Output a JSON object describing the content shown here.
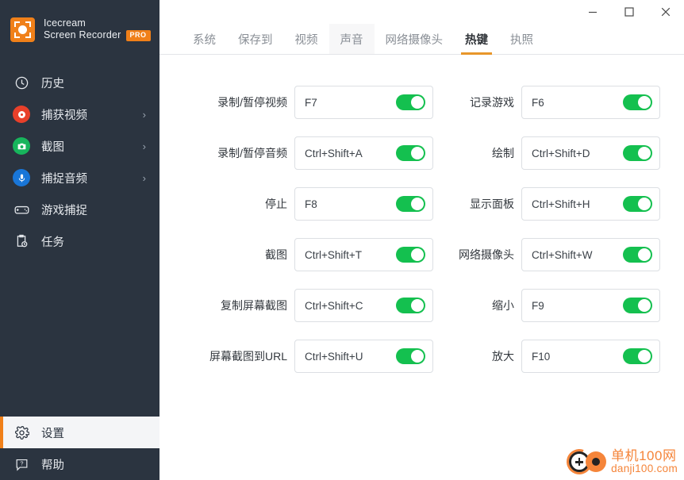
{
  "app": {
    "brand_line1": "Icecream",
    "brand_line2": "Screen Recorder",
    "pro_badge": "PRO",
    "logo_icon": "recorder-frame-icon"
  },
  "window_controls": {
    "minimize": "–",
    "maximize": "☐",
    "close": "✕"
  },
  "sidebar": {
    "items": [
      {
        "label": "历史",
        "icon": "clock-icon",
        "chevron": "",
        "active": false
      },
      {
        "label": "捕获视频",
        "icon": "record-circle-icon",
        "chevron": "›",
        "active": false
      },
      {
        "label": "截图",
        "icon": "camera-icon",
        "chevron": "›",
        "active": false
      },
      {
        "label": "捕捉音频",
        "icon": "microphone-icon",
        "chevron": "›",
        "active": false
      },
      {
        "label": "游戏捕捉",
        "icon": "gamepad-icon",
        "chevron": "",
        "active": false
      },
      {
        "label": "任务",
        "icon": "clipboard-clock-icon",
        "chevron": "",
        "active": false
      }
    ],
    "bottom_items": [
      {
        "label": "设置",
        "icon": "gear-icon",
        "active": true
      },
      {
        "label": "帮助",
        "icon": "help-bubble-icon",
        "active": false
      }
    ]
  },
  "tabs": [
    {
      "label": "系统",
      "active": false,
      "hover": false
    },
    {
      "label": "保存到",
      "active": false,
      "hover": false
    },
    {
      "label": "视频",
      "active": false,
      "hover": false
    },
    {
      "label": "声音",
      "active": false,
      "hover": true
    },
    {
      "label": "网络摄像头",
      "active": false,
      "hover": false
    },
    {
      "label": "热键",
      "active": true,
      "hover": false
    },
    {
      "label": "执照",
      "active": false,
      "hover": false
    }
  ],
  "hotkeys": {
    "left_column": [
      {
        "label": "录制/暂停视频",
        "value": "F7",
        "enabled": true
      },
      {
        "label": "录制/暂停音频",
        "value": "Ctrl+Shift+A",
        "enabled": true
      },
      {
        "label": "停止",
        "value": "F8",
        "enabled": true
      },
      {
        "label": "截图",
        "value": "Ctrl+Shift+T",
        "enabled": true
      },
      {
        "label": "复制屏幕截图",
        "value": "Ctrl+Shift+C",
        "enabled": true
      },
      {
        "label": "屏幕截图到URL",
        "value": "Ctrl+Shift+U",
        "enabled": true
      }
    ],
    "right_column": [
      {
        "label": "记录游戏",
        "value": "F6",
        "enabled": true
      },
      {
        "label": "绘制",
        "value": "Ctrl+Shift+D",
        "enabled": true
      },
      {
        "label": "显示面板",
        "value": "Ctrl+Shift+H",
        "enabled": true
      },
      {
        "label": "网络摄像头",
        "value": "Ctrl+Shift+W",
        "enabled": true
      },
      {
        "label": "缩小",
        "value": "F9",
        "enabled": true
      },
      {
        "label": "放大",
        "value": "F10",
        "enabled": true
      }
    ]
  },
  "watermark": {
    "line1": "单机100网",
    "line2": "danji100.com"
  },
  "colors": {
    "sidebar_bg": "#2b3440",
    "accent_orange": "#f08019",
    "tab_underline": "#e8962a",
    "toggle_on": "#14c04f",
    "watermark_orange": "#f5853a"
  }
}
